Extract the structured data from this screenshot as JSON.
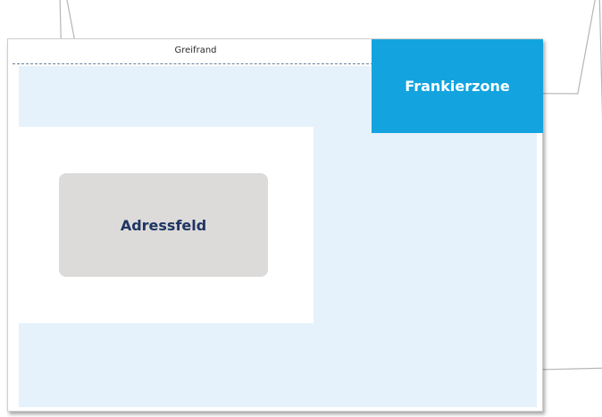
{
  "envelope": {
    "grip_edge_label": "Greifrand",
    "franking_zone_label": "Frankierzone",
    "address_field_label": "Adressfeld"
  },
  "colors": {
    "franking_zone": "#13a4df",
    "content_area": "#e5f2fb",
    "address_field": "#dcdbd9",
    "address_text": "#1f3563",
    "grip_line": "#6a7d9c"
  }
}
